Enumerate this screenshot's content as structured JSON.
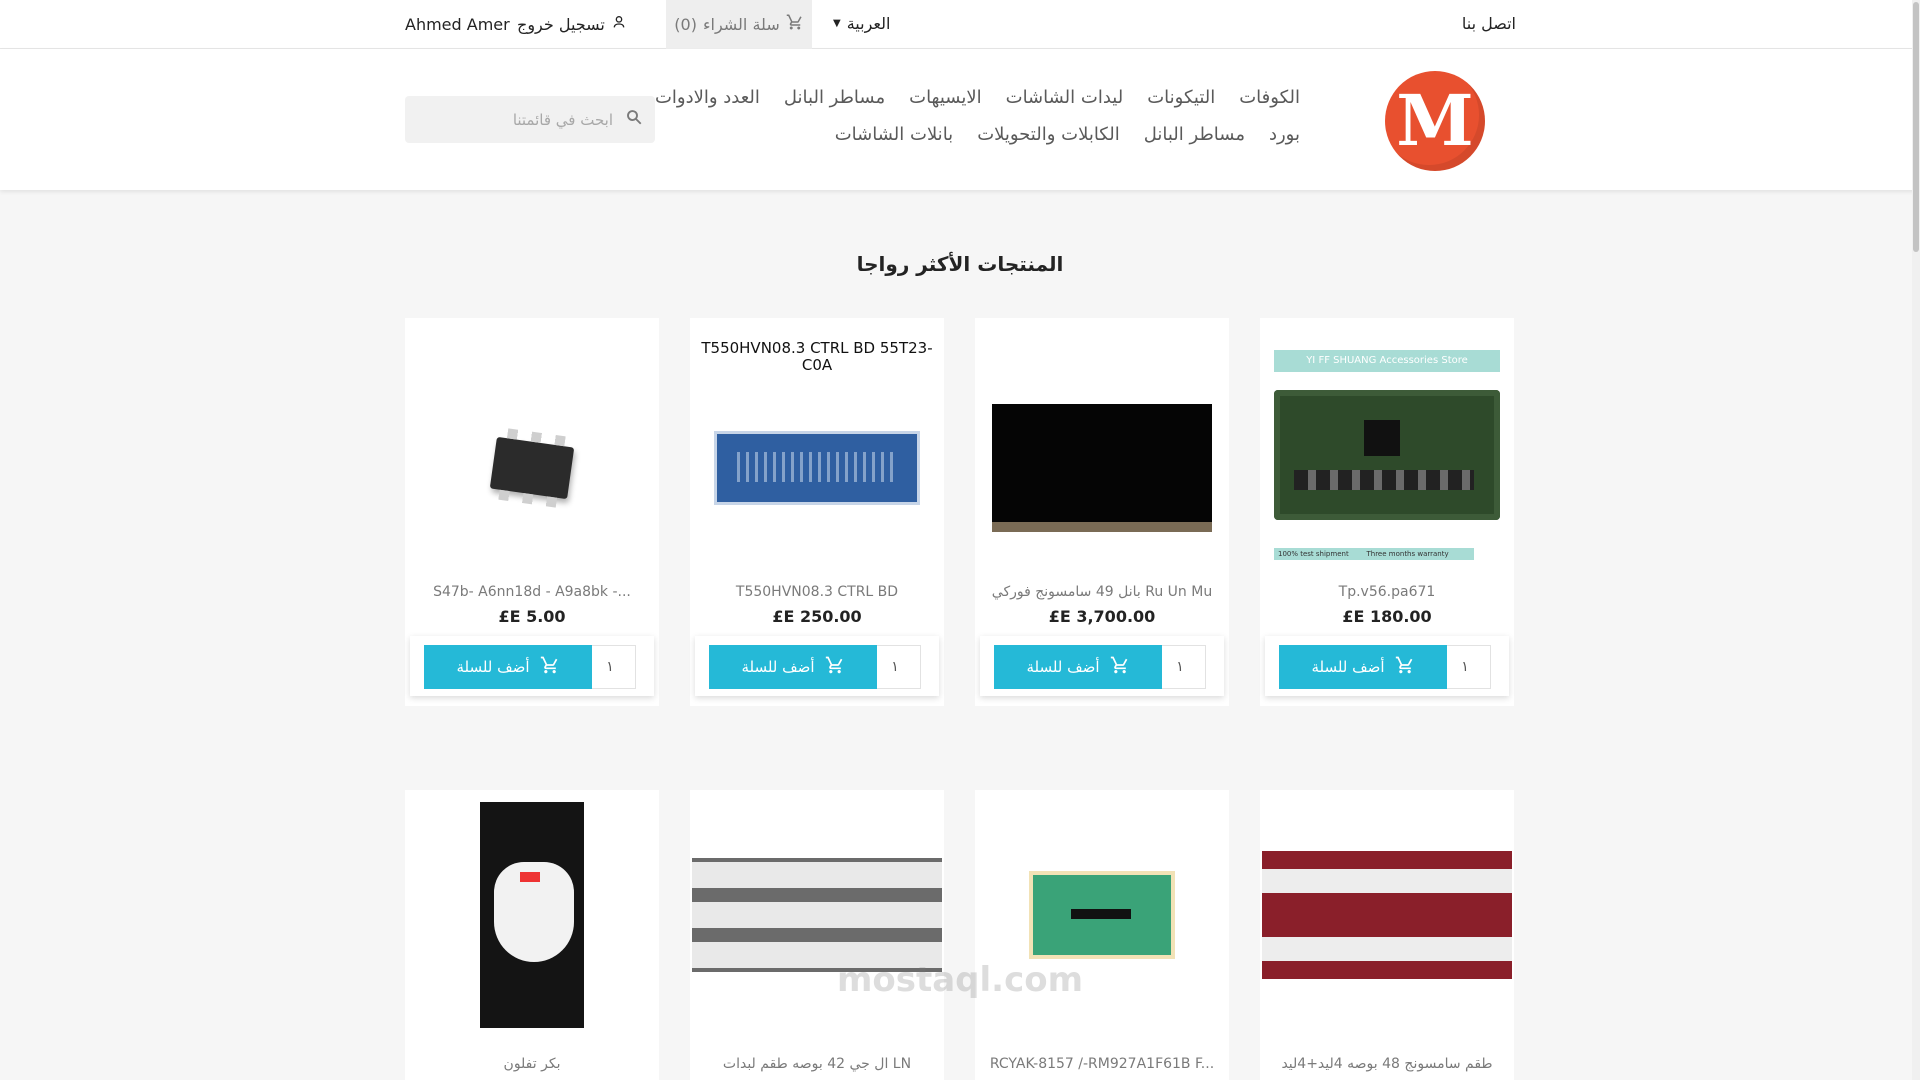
{
  "topbar": {
    "contact_label": "اتصل بنا",
    "language_label": "العربية",
    "cart_label": "سلة الشراء",
    "cart_count": "(0)",
    "logout_label": "تسجيل خروج",
    "username": "Ahmed Amer"
  },
  "header": {
    "logo_letter": "M",
    "menu_row1": [
      "الكوفات",
      "التيكونات",
      "ليدات الشاشات",
      "الايسيهات",
      "مساطر البانل",
      "العدد والادوات"
    ],
    "menu_row2": [
      "بورد",
      "مساطر البانل",
      "الكابلات والتحويلات",
      "بانلات الشاشات"
    ],
    "search_placeholder": "ابحث في قائمتنا"
  },
  "section": {
    "title": "المنتجات الأكثر رواجا"
  },
  "products_row1": [
    {
      "name": "Tp.v56.pa671",
      "price": "£E 180.00",
      "qty": "١",
      "add_label": "أضف للسلة",
      "image": "tv-mainboard",
      "image_texts": [
        "YI FF SHUANG Accessories Store",
        "100% test shipment",
        "Three months warranty"
      ]
    },
    {
      "name": "بانل 49 سامسونج فوركي Ru Un Mu",
      "price": "£E 3,700.00",
      "qty": "١",
      "add_label": "أضف للسلة",
      "image": "lcd-panel"
    },
    {
      "name": "T550HVN08.3 CTRL BD",
      "price": "£E 250.00",
      "qty": "١",
      "add_label": "أضف للسلة",
      "image": "tcon-board",
      "image_label": "T550HVN08.3 CTRL BD 55T23-C0A"
    },
    {
      "name": "S47b- A6nn18d - A9a8bk -...",
      "price": "£E 5.00",
      "qty": "١",
      "add_label": "أضف للسلة",
      "image": "ic-chip"
    }
  ],
  "products_row2": [
    {
      "name": "طقم سامسونج 48 بوصه 4ليد+4ليد",
      "image": "led-strips-red"
    },
    {
      "name": "RCYAK-8157 /-RM927A1F61B F...",
      "image": "flex-adapter"
    },
    {
      "name": "ال جي 42 بوصه طقم لبدات LN",
      "image": "led-strips"
    },
    {
      "name": "بكر تفلون",
      "image": "teflon-tape"
    }
  ],
  "icons": {
    "cart": "shopping-cart-icon",
    "user": "user-icon",
    "search": "search-icon",
    "caret": "caret-down-icon"
  },
  "colors": {
    "accent": "#25b9d7",
    "logo": "#e8502f",
    "background": "#f6f6f6"
  },
  "watermark": {
    "text": "mostaql.com"
  }
}
